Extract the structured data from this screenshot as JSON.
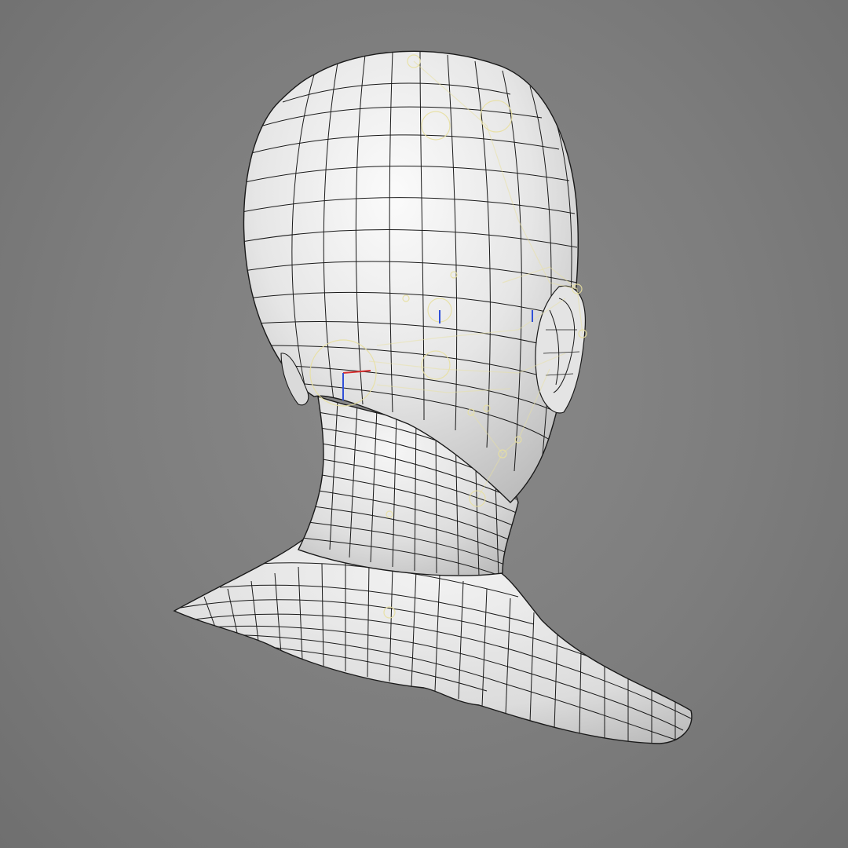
{
  "viewport": {
    "background_color": "#7d7d7d",
    "mesh_fill_color": "#e9e9e9",
    "mesh_wire_color": "#1a1a1a",
    "rig_helper_color": "#e8e0a0",
    "axis_colors": {
      "x": "#d83030",
      "y": "#3050d8"
    }
  },
  "model": {
    "subject": "head-and-neck-base-mesh",
    "view": "back-three-quarter",
    "display_mode": "shaded-wireframe",
    "rig_helpers_visible": true
  }
}
